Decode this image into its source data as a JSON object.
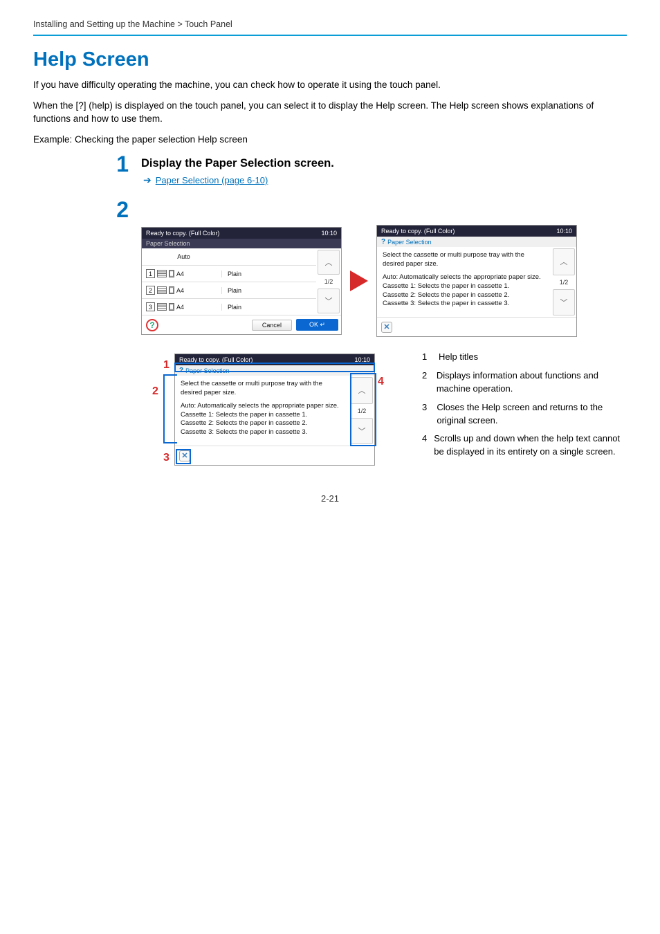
{
  "breadcrumb": "Installing and Setting up the Machine > Touch Panel",
  "title": "Help Screen",
  "para1": "If you have difficulty operating the machine, you can check how to operate it using the touch panel.",
  "para2": "When the [?] (help) is displayed on the touch panel, you can select it to display the Help screen. The Help screen shows explanations of functions and how to use them.",
  "para3": "Example: Checking the paper selection Help screen",
  "step1_num": "1",
  "step1_title": "Display the Paper Selection screen.",
  "step1_link": "Paper Selection (page 6-10)",
  "step2_num": "2",
  "panel": {
    "status": "Ready to copy. (Full Color)",
    "time": "10:10",
    "sub": "Paper Selection",
    "rows": [
      {
        "l": "Auto",
        "r": ""
      },
      {
        "l": "A4",
        "num": "1",
        "r": "Plain"
      },
      {
        "l": "A4",
        "num": "2",
        "r": "Plain"
      },
      {
        "l": "A4",
        "num": "3",
        "r": "Plain"
      }
    ],
    "page": "1/2",
    "cancel": "Cancel",
    "ok": "OK"
  },
  "help_panel": {
    "status": "Ready to copy. (Full Color)",
    "time": "10:10",
    "sub": "Paper Selection",
    "line1": "Select the cassette or multi purpose tray with the desired paper size.",
    "line2": "Auto: Automatically selects the appropriate paper size.",
    "line3": "Cassette 1: Selects the paper in cassette 1.",
    "line4": "Cassette 2: Selects the paper in cassette 2.",
    "line5": "Cassette 3: Selects the paper in cassette 3.",
    "page": "1/2"
  },
  "callouts": {
    "c1": "1",
    "c2": "2",
    "c3": "3",
    "c4": "4"
  },
  "legend": {
    "l1": "Help titles",
    "l2": "Displays information about functions and machine operation.",
    "l3": "Closes the Help screen and returns to the original screen.",
    "l4": "Scrolls up and down when the help text cannot be displayed in its entirety on a single screen."
  },
  "page_num": "2-21"
}
